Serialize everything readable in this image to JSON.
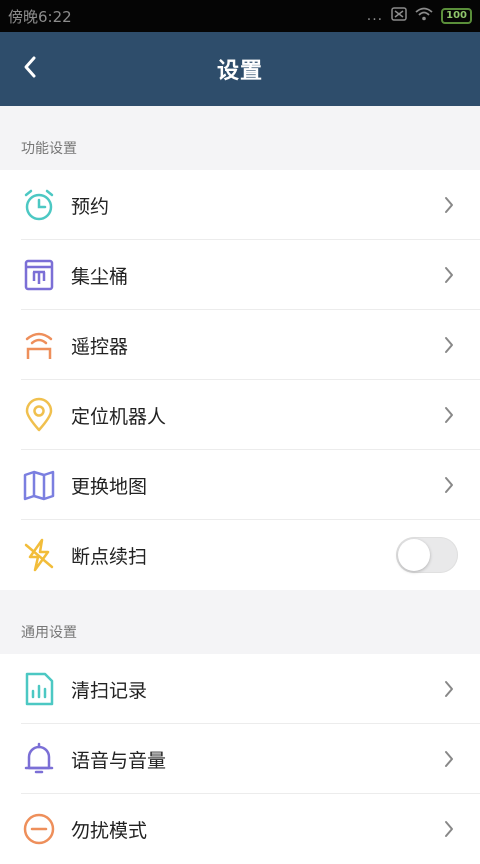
{
  "status_bar": {
    "time": "傍晚6:22",
    "dots": "...",
    "battery": "100"
  },
  "nav": {
    "title": "设置",
    "back_icon": "chevron-left-icon"
  },
  "sections": [
    {
      "title": "功能设置",
      "items": [
        {
          "label": "预约",
          "icon": "alarm-clock-icon",
          "color": "#4cc8c3"
        },
        {
          "label": "集尘桶",
          "icon": "dust-bin-icon",
          "color": "#7b6fd6"
        },
        {
          "label": "遥控器",
          "icon": "remote-control-icon",
          "color": "#ee8f5b"
        },
        {
          "label": "定位机器人",
          "icon": "location-pin-icon",
          "color": "#f0c04e"
        },
        {
          "label": "更换地图",
          "icon": "map-icon",
          "color": "#7b7fe0"
        },
        {
          "label": "断点续扫",
          "icon": "lightning-icon",
          "color": "#f2bd3a",
          "toggle": false
        }
      ]
    },
    {
      "title": "通用设置",
      "items": [
        {
          "label": "清扫记录",
          "icon": "report-icon",
          "color": "#4cc8c3"
        },
        {
          "label": "语音与音量",
          "icon": "bell-icon",
          "color": "#7b6fd6"
        },
        {
          "label": "勿扰模式",
          "icon": "do-not-disturb-icon",
          "color": "#ee8f5b"
        }
      ]
    }
  ]
}
